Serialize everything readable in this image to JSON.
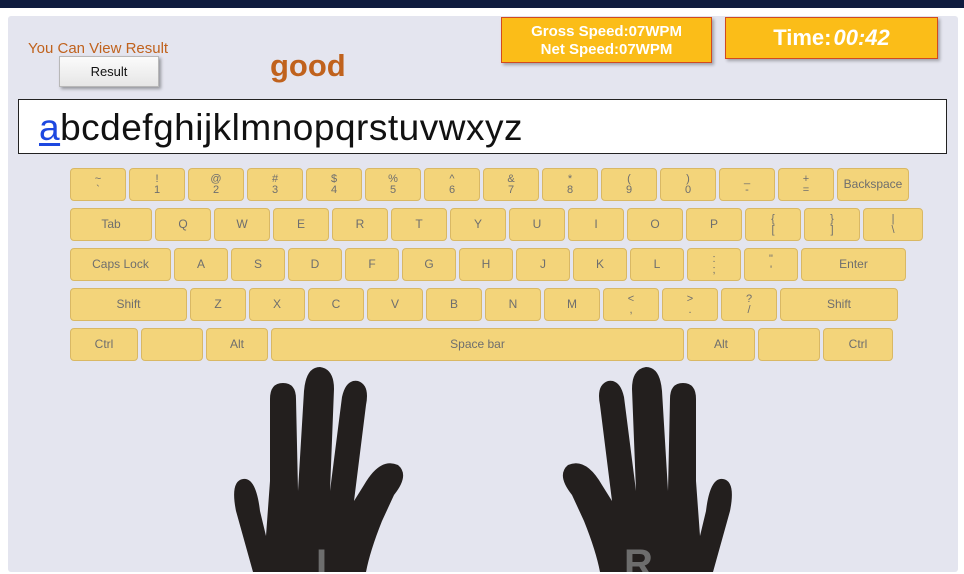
{
  "header": {
    "view_result_text": "You Can View Result",
    "result_button": "Result",
    "feedback": "good",
    "gross_speed": "Gross Speed:07WPM",
    "net_speed": "Net Speed:07WPM",
    "time_label": "Time:",
    "time_value": "00:42"
  },
  "typing": {
    "current_char": "a",
    "remaining_text": "bcdefghijklmnopqrstuvwxyz"
  },
  "keyboard": {
    "row1": [
      {
        "top": "~",
        "bot": "`"
      },
      {
        "top": "!",
        "bot": "1"
      },
      {
        "top": "@",
        "bot": "2"
      },
      {
        "top": "#",
        "bot": "3"
      },
      {
        "top": "$",
        "bot": "4"
      },
      {
        "top": "%",
        "bot": "5"
      },
      {
        "top": "^",
        "bot": "6"
      },
      {
        "top": "&",
        "bot": "7"
      },
      {
        "top": "*",
        "bot": "8"
      },
      {
        "top": "(",
        "bot": "9"
      },
      {
        "top": ")",
        "bot": "0"
      },
      {
        "top": "_",
        "bot": "-"
      },
      {
        "top": "+",
        "bot": "="
      },
      {
        "label": "Backspace"
      }
    ],
    "row2": [
      {
        "label": "Tab"
      },
      {
        "label": "Q"
      },
      {
        "label": "W"
      },
      {
        "label": "E"
      },
      {
        "label": "R"
      },
      {
        "label": "T"
      },
      {
        "label": "Y"
      },
      {
        "label": "U"
      },
      {
        "label": "I"
      },
      {
        "label": "O"
      },
      {
        "label": "P"
      },
      {
        "top": "{",
        "bot": "["
      },
      {
        "top": "}",
        "bot": "]"
      },
      {
        "top": "|",
        "bot": "\\"
      }
    ],
    "row3": [
      {
        "label": "Caps Lock"
      },
      {
        "label": "A"
      },
      {
        "label": "S"
      },
      {
        "label": "D"
      },
      {
        "label": "F"
      },
      {
        "label": "G"
      },
      {
        "label": "H"
      },
      {
        "label": "J"
      },
      {
        "label": "K"
      },
      {
        "label": "L"
      },
      {
        "top": ":",
        "bot": ";"
      },
      {
        "top": "\"",
        "bot": "'"
      },
      {
        "label": "Enter"
      }
    ],
    "row4": [
      {
        "label": "Shift"
      },
      {
        "label": "Z"
      },
      {
        "label": "X"
      },
      {
        "label": "C"
      },
      {
        "label": "V"
      },
      {
        "label": "B"
      },
      {
        "label": "N"
      },
      {
        "label": "M"
      },
      {
        "top": "<",
        "bot": ","
      },
      {
        "top": ">",
        "bot": "."
      },
      {
        "top": "?",
        "bot": "/"
      },
      {
        "label": "Shift"
      }
    ],
    "row5": [
      {
        "label": "Ctrl"
      },
      {
        "label": ""
      },
      {
        "label": "Alt"
      },
      {
        "label": "Space bar"
      },
      {
        "label": "Alt"
      },
      {
        "label": ""
      },
      {
        "label": "Ctrl"
      }
    ]
  },
  "colors": {
    "key_fill": "#f3d47a",
    "accent": "#fbbd18",
    "feedback": "#c0621d",
    "cursor_char": "#1d48e0",
    "hand": "#231f1e"
  },
  "hands": {
    "left_letter": "L",
    "right_letter": "R"
  }
}
